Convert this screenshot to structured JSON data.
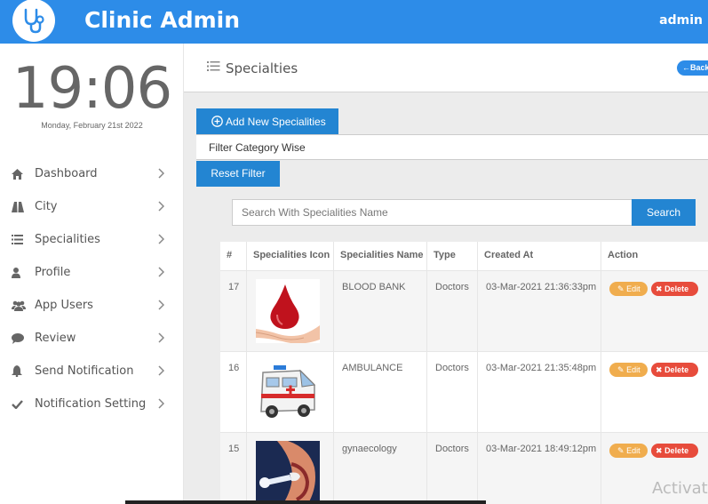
{
  "header": {
    "app_title": "Clinic Admin",
    "user": "admin",
    "logo_icon": "stethoscope-icon",
    "color": "#2d8ce8"
  },
  "sidebar": {
    "clock_time": "19:06",
    "clock_date": "Monday, February 21st 2022",
    "items": [
      {
        "label": "Dashboard",
        "icon": "home-icon"
      },
      {
        "label": "City",
        "icon": "road-icon"
      },
      {
        "label": "Specialities",
        "icon": "list-icon"
      },
      {
        "label": "Profile",
        "icon": "user-icon"
      },
      {
        "label": "App Users",
        "icon": "users-icon"
      },
      {
        "label": "Review",
        "icon": "comment-icon"
      },
      {
        "label": "Send Notification",
        "icon": "bell-icon"
      },
      {
        "label": "Notification Setting",
        "icon": "check-icon"
      }
    ]
  },
  "page": {
    "title": "Specialties",
    "back_label": "Back"
  },
  "actions": {
    "add_label": "Add New Specialities",
    "filter_label": "Filter Category Wise",
    "reset_label": "Reset Filter"
  },
  "search": {
    "placeholder": "Search With Specialities Name",
    "button_label": "Search"
  },
  "table": {
    "columns": [
      "#",
      "Specialities Icon",
      "Specialities Name",
      "Type",
      "Created At",
      "Action"
    ],
    "rows": [
      {
        "id": "17",
        "icon": "blood-drop-image",
        "name": "BLOOD BANK",
        "type": "Doctors",
        "created": "03-Mar-2021 21:36:33pm",
        "edit": "Edit",
        "delete": "Delete"
      },
      {
        "id": "16",
        "icon": "ambulance-image",
        "name": "AMBULANCE",
        "type": "Doctors",
        "created": "03-Mar-2021 21:35:48pm",
        "edit": "Edit",
        "delete": "Delete"
      },
      {
        "id": "15",
        "icon": "gynaecology-image",
        "name": "gynaecology",
        "type": "Doctors",
        "created": "03-Mar-2021 18:49:12pm",
        "edit": "Edit",
        "delete": "Delete"
      }
    ]
  },
  "watermark": "Activate"
}
